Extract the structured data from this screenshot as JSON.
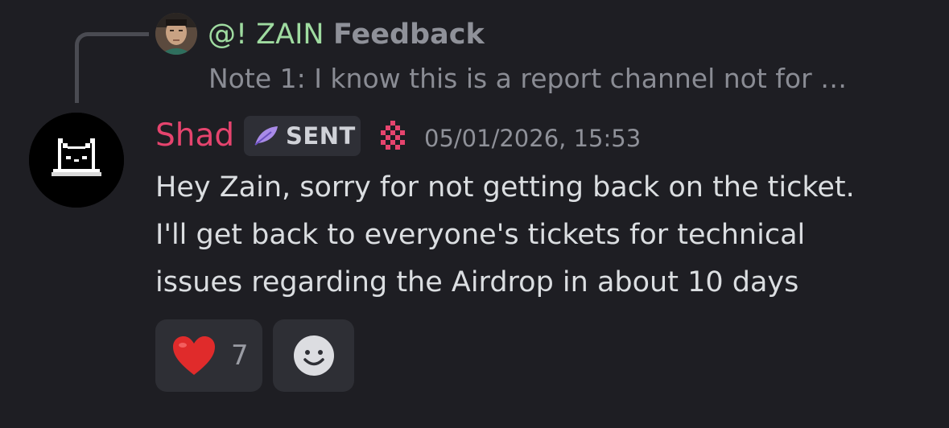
{
  "reply": {
    "author": "@! ZAIN",
    "label": "Feedback",
    "snippet": "Note 1: I know this is a report channel not for …",
    "avatar_icon": "user-avatar-photo"
  },
  "message": {
    "author": "Shad",
    "author_color": "#e6446e",
    "tag": "SENT",
    "tag_icon": "feather-icon",
    "flair_icon": "pixel-badge-icon",
    "timestamp": "05/01/2026, 15:53",
    "lines": [
      "Hey Zain, sorry for not getting back on the ticket.",
      "I'll get back to everyone's tickets for technical",
      "issues regarding the Airdrop in about 10 days"
    ],
    "avatar_icon": "pixel-cat-avatar"
  },
  "reactions": [
    {
      "emoji": "heart-icon",
      "count": "7"
    }
  ],
  "add_reaction_icon": "smiley-icon",
  "colors": {
    "background": "#1e1e23",
    "reply_author": "#9fdba0",
    "chip": "#2e2f35"
  }
}
